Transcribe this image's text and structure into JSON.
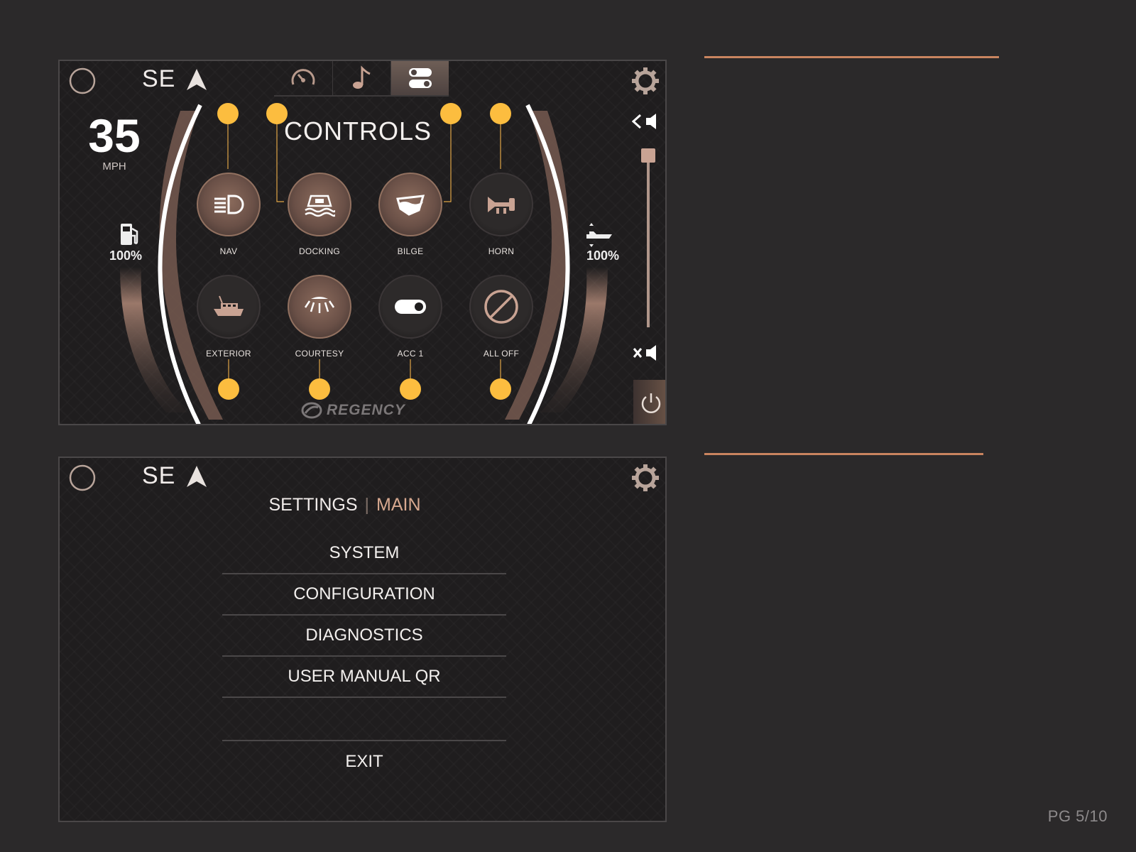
{
  "top_screen": {
    "heading": "SE",
    "tabs": [
      {
        "name": "gauges",
        "icon": "speedometer-icon",
        "active": false
      },
      {
        "name": "music",
        "icon": "music-note-icon",
        "active": false
      },
      {
        "name": "controls",
        "icon": "toggles-icon",
        "active": true
      }
    ],
    "speed": {
      "value": "35",
      "unit": "MPH"
    },
    "fuel_percent": "100%",
    "trim_percent": "100%",
    "title": "CONTROLS",
    "controls": [
      {
        "label": "NAV",
        "icon": "headlight-icon",
        "on": true
      },
      {
        "label": "DOCKING",
        "icon": "docking-light-icon",
        "on": true
      },
      {
        "label": "BILGE",
        "icon": "bilge-pump-icon",
        "on": true
      },
      {
        "label": "HORN",
        "icon": "horn-icon",
        "on": false
      },
      {
        "label": "EXTERIOR",
        "icon": "boat-exterior-icon",
        "on": false
      },
      {
        "label": "COURTESY",
        "icon": "courtesy-light-icon",
        "on": true
      },
      {
        "label": "ACC 1",
        "icon": "toggle-switch-icon",
        "on": false
      },
      {
        "label": "ALL OFF",
        "icon": "all-off-icon",
        "on": false
      }
    ],
    "logo": "REGENCY",
    "volume": {
      "level": 0.97
    }
  },
  "bottom_screen": {
    "heading": "SE",
    "breadcrumb": {
      "section": "SETTINGS",
      "page": "MAIN"
    },
    "menu": [
      "SYSTEM",
      "CONFIGURATION",
      "DIAGNOSTICS",
      "USER MANUAL QR"
    ],
    "exit": "EXIT"
  },
  "colors": {
    "accent": "#c9845f",
    "marker": "#fcbd3f",
    "copper": "#b0968a"
  },
  "page_number": "PG 5/10"
}
